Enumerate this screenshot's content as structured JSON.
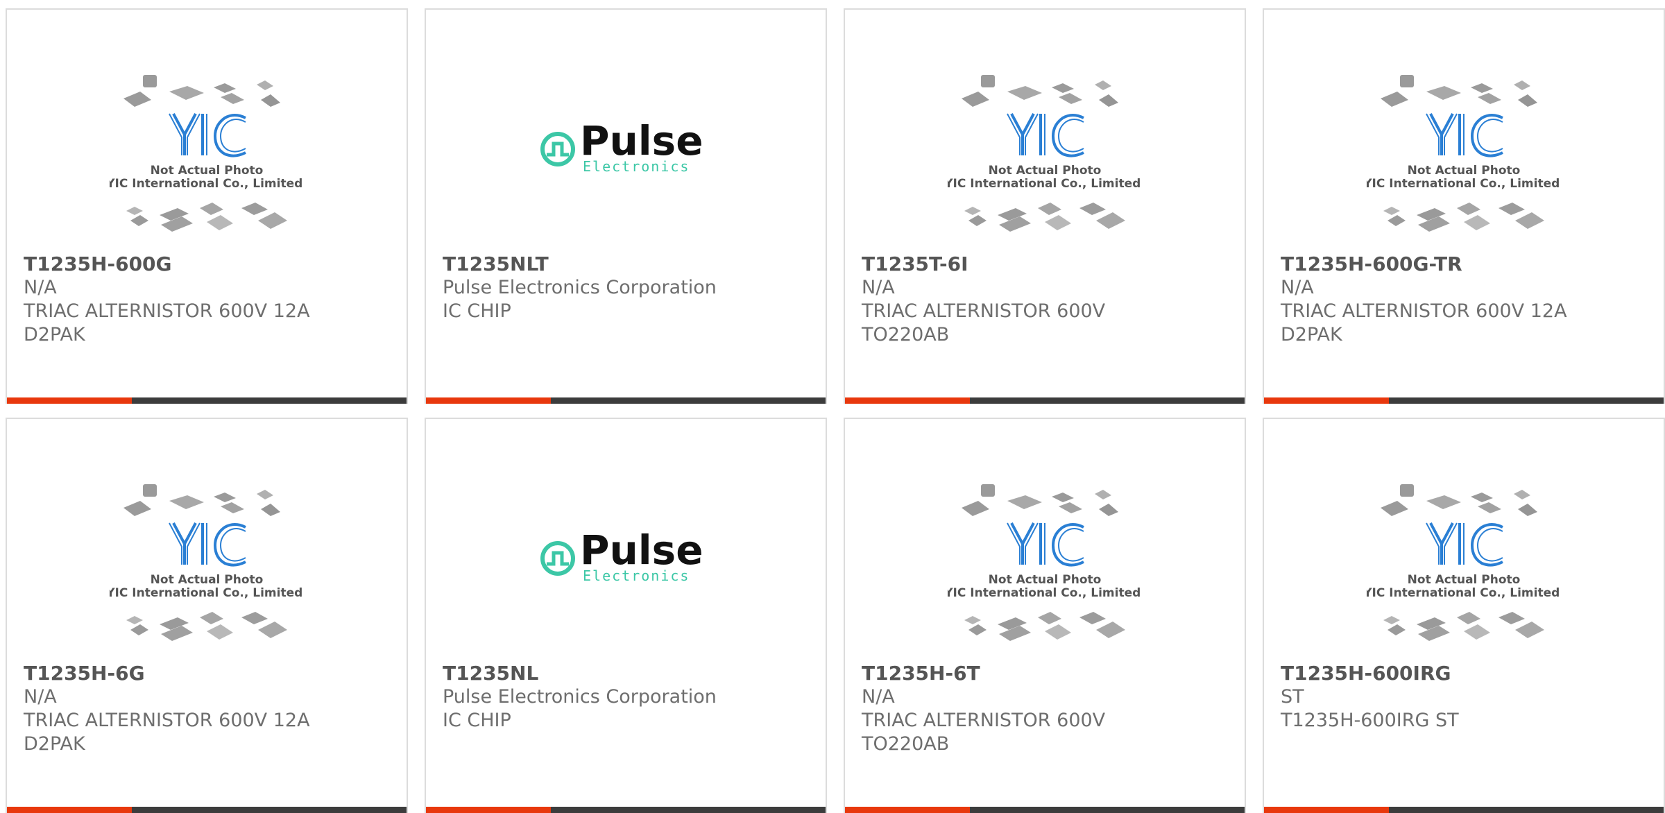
{
  "colors": {
    "accent": "#e8380d",
    "bar": "#3c3c3c",
    "text": "#6e6e6e",
    "border": "#dcdcdc",
    "pulse_teal": "#3cc7a6",
    "yic_blue": "#2a7fd4"
  },
  "logos": {
    "yic": {
      "icon": "yic-placeholder-icon",
      "mark": "YIC",
      "caption_1": "Not Actual Photo",
      "caption_2": "YIC International Co., Limited."
    },
    "pulse": {
      "icon": "pulse-electronics-logo-icon",
      "name": "Pulse",
      "sub": "Electronics"
    }
  },
  "products": [
    {
      "part": "T1235H-600G",
      "maker": "N/A",
      "desc_1": "TRIAC ALTERNISTOR 600V 12A",
      "desc_2": "D2PAK",
      "logo": "yic"
    },
    {
      "part": "T1235NLT",
      "maker": "Pulse Electronics Corporation",
      "desc_1": "IC CHIP",
      "desc_2": "",
      "logo": "pulse"
    },
    {
      "part": "T1235T-6I",
      "maker": "N/A",
      "desc_1": "TRIAC ALTERNISTOR 600V",
      "desc_2": "TO220AB",
      "logo": "yic"
    },
    {
      "part": "T1235H-600G-TR",
      "maker": "N/A",
      "desc_1": "TRIAC ALTERNISTOR 600V 12A",
      "desc_2": "D2PAK",
      "logo": "yic"
    },
    {
      "part": "T1235H-6G",
      "maker": "N/A",
      "desc_1": "TRIAC ALTERNISTOR 600V 12A",
      "desc_2": "D2PAK",
      "logo": "yic"
    },
    {
      "part": "T1235NL",
      "maker": "Pulse Electronics Corporation",
      "desc_1": "IC CHIP",
      "desc_2": "",
      "logo": "pulse"
    },
    {
      "part": "T1235H-6T",
      "maker": "N/A",
      "desc_1": "TRIAC ALTERNISTOR 600V",
      "desc_2": "TO220AB",
      "logo": "yic"
    },
    {
      "part": "T1235H-600IRG",
      "maker": "ST",
      "desc_1": "T1235H-600IRG ST",
      "desc_2": "",
      "logo": "yic"
    }
  ]
}
